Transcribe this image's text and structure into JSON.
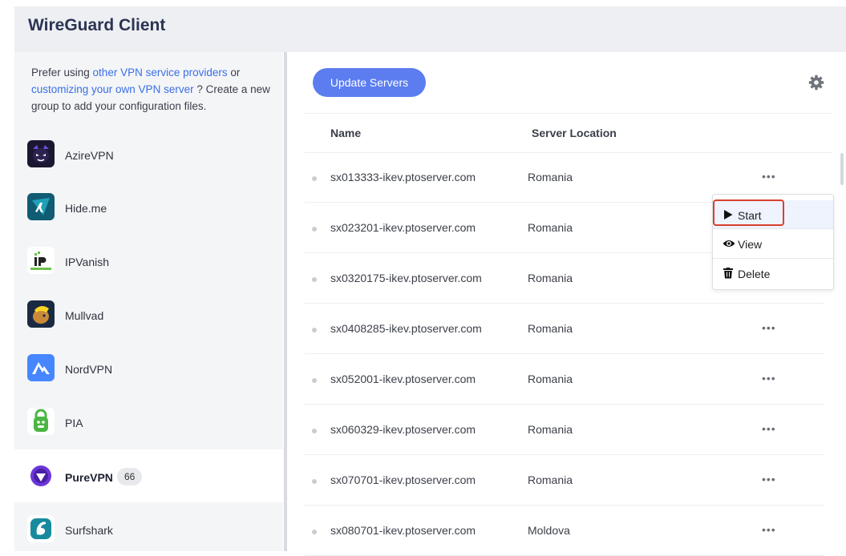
{
  "app": {
    "title": "WireGuard Client"
  },
  "sidebar": {
    "promo": {
      "text_1": "Prefer using ",
      "link_1": "other VPN service providers",
      "text_2": " or ",
      "link_2": "customizing your own VPN server",
      "text_3": " ? Create a new group to add your configuration files."
    },
    "items": [
      {
        "label": "AzireVPN",
        "icon": "azirevpn-logo",
        "color": "#1b1730"
      },
      {
        "label": "Hide.me",
        "icon": "hideme-logo",
        "color": "#0f5c73"
      },
      {
        "label": "IPVanish",
        "icon": "ipvanish-logo",
        "color": "#ffffff"
      },
      {
        "label": "Mullvad",
        "icon": "mullvad-logo",
        "color": "#1b2a43"
      },
      {
        "label": "NordVPN",
        "icon": "nordvpn-logo",
        "color": "#4687ff"
      },
      {
        "label": "PIA",
        "icon": "pia-logo",
        "color": "#4bb543"
      },
      {
        "label": "PureVPN",
        "icon": "purevpn-logo",
        "color": "#6c37d9",
        "active": true,
        "badge": "66"
      },
      {
        "label": "Surfshark",
        "icon": "surfshark-logo",
        "color": "#178a9e"
      }
    ]
  },
  "toolbar": {
    "update_label": "Update Servers",
    "settings_icon": "gear-icon",
    "accent_color": "#5b7df0"
  },
  "table": {
    "columns": [
      "Name",
      "Server Location"
    ],
    "rows": [
      {
        "name": "sx013333-ikev.ptoserver.com",
        "location": "Romania",
        "more": "•••"
      },
      {
        "name": "sx023201-ikev.ptoserver.com",
        "location": "Romania",
        "more": ""
      },
      {
        "name": "sx0320175-ikev.ptoserver.com",
        "location": "Romania",
        "more": ""
      },
      {
        "name": "sx0408285-ikev.ptoserver.com",
        "location": "Romania",
        "more": "•••"
      },
      {
        "name": "sx052001-ikev.ptoserver.com",
        "location": "Romania",
        "more": "•••"
      },
      {
        "name": "sx060329-ikev.ptoserver.com",
        "location": "Romania",
        "more": "•••"
      },
      {
        "name": "sx070701-ikev.ptoserver.com",
        "location": "Romania",
        "more": "•••"
      },
      {
        "name": "sx080701-ikev.ptoserver.com",
        "location": "Moldova",
        "more": "•••"
      }
    ]
  },
  "context_menu": {
    "items": [
      {
        "label": "Start",
        "icon": "play-icon",
        "highlighted": true
      },
      {
        "label": "View",
        "icon": "eye-icon"
      },
      {
        "label": "Delete",
        "icon": "trash-icon"
      }
    ],
    "highlight_color": "#d9402c"
  }
}
